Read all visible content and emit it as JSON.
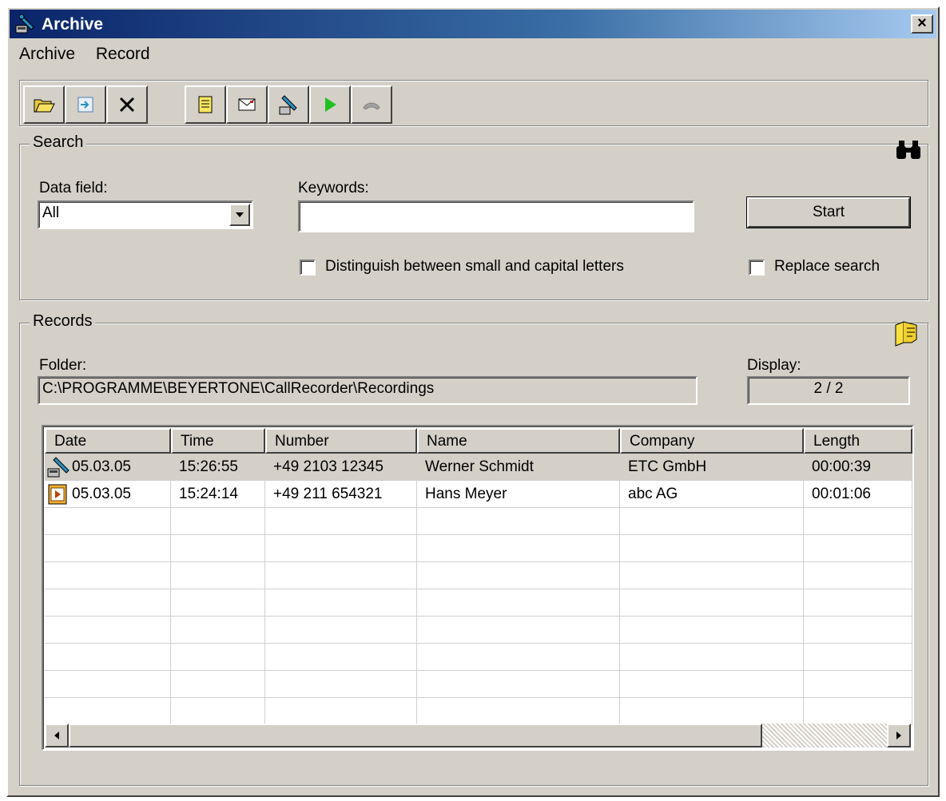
{
  "window": {
    "title": "Archive",
    "close_label": "×"
  },
  "menu": {
    "items": [
      {
        "label": "Archive"
      },
      {
        "label": "Record"
      }
    ]
  },
  "toolbar": {
    "buttons": [
      {
        "icon": "open-folder-icon"
      },
      {
        "icon": "export-icon"
      },
      {
        "icon": "delete-icon"
      },
      {
        "icon": "notes-icon"
      },
      {
        "icon": "email-icon"
      },
      {
        "icon": "call-recorder-icon"
      },
      {
        "icon": "play-icon"
      },
      {
        "icon": "hangup-icon"
      }
    ]
  },
  "search": {
    "legend": "Search",
    "data_field_label": "Data field:",
    "data_field_value": "All",
    "keywords_label": "Keywords:",
    "keywords_value": "",
    "start_label": "Start",
    "case_checkbox_label": "Distinguish between small and capital letters",
    "case_checked": false,
    "replace_checkbox_label": "Replace search",
    "replace_checked": false
  },
  "records": {
    "legend": "Records",
    "folder_label": "Folder:",
    "folder_value": "C:\\PROGRAMME\\BEYERTONE\\CallRecorder\\Recordings",
    "display_label": "Display:",
    "display_value": "2 / 2",
    "columns": [
      "Date",
      "Time",
      "Number",
      "Name",
      "Company",
      "Length"
    ],
    "rows": [
      {
        "icon": "phone-recording-icon",
        "date": "05.03.05",
        "time": "15:26:55",
        "number": "+49 2103 12345",
        "name": "Werner Schmidt",
        "company": "ETC GmbH",
        "length": "00:00:39",
        "selected": true
      },
      {
        "icon": "video-file-icon",
        "date": "05.03.05",
        "time": "15:24:14",
        "number": "+49 211 654321",
        "name": "Hans Meyer",
        "company": "abc AG",
        "length": "00:01:06",
        "selected": false
      }
    ]
  },
  "colors": {
    "title_gradient_start": "#0a246a",
    "face": "#d4d0c8"
  }
}
